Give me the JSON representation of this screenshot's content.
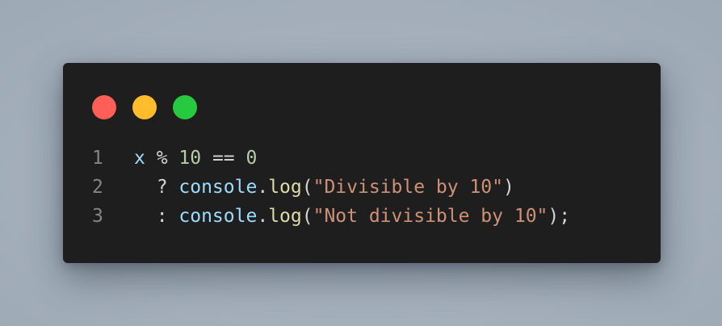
{
  "colors": {
    "background": "#a6b1bd",
    "window": "#1e1e1e",
    "dot_red": "#ff5f56",
    "dot_yellow": "#ffbd2e",
    "dot_green": "#27c93f",
    "variable": "#9cdcfe",
    "number": "#b5cea8",
    "function": "#dcdcaa",
    "string": "#ce9178",
    "operator": "#d4d4d4",
    "line_number": "#858585"
  },
  "window_controls": [
    {
      "name": "close",
      "icon": "red-dot"
    },
    {
      "name": "minimize",
      "icon": "yellow-dot"
    },
    {
      "name": "maximize",
      "icon": "green-dot"
    }
  ],
  "code": {
    "lines": [
      {
        "number": "1",
        "tokens": [
          {
            "text": "x",
            "kind": "var"
          },
          {
            "text": " % ",
            "kind": "op"
          },
          {
            "text": "10",
            "kind": "num"
          },
          {
            "text": " == ",
            "kind": "op"
          },
          {
            "text": "0",
            "kind": "num"
          }
        ]
      },
      {
        "number": "2",
        "tokens": [
          {
            "text": "  ? ",
            "kind": "op"
          },
          {
            "text": "console",
            "kind": "var"
          },
          {
            "text": ".",
            "kind": "punc"
          },
          {
            "text": "log",
            "kind": "fn"
          },
          {
            "text": "(",
            "kind": "punc"
          },
          {
            "text": "\"Divisible by 10\"",
            "kind": "str"
          },
          {
            "text": ")",
            "kind": "punc"
          }
        ]
      },
      {
        "number": "3",
        "tokens": [
          {
            "text": "  : ",
            "kind": "op"
          },
          {
            "text": "console",
            "kind": "var"
          },
          {
            "text": ".",
            "kind": "punc"
          },
          {
            "text": "log",
            "kind": "fn"
          },
          {
            "text": "(",
            "kind": "punc"
          },
          {
            "text": "\"Not divisible by 10\"",
            "kind": "str"
          },
          {
            "text": ");",
            "kind": "punc"
          }
        ]
      }
    ]
  }
}
